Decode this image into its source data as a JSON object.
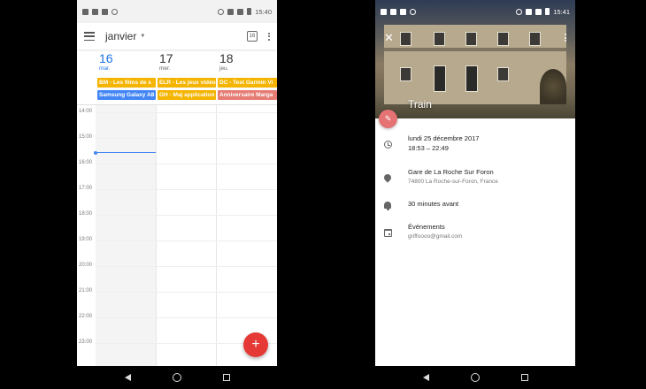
{
  "colors": {
    "primary_blue": "#1a73e8",
    "event_orange": "#f4b400",
    "event_blue": "#4285f4",
    "event_red": "#e67c73",
    "fab_red": "#e53935",
    "edit_fab_red": "#e57373"
  },
  "left": {
    "statusbar": {
      "time": "15:40"
    },
    "appbar": {
      "title": "janvier",
      "today_icon_text": "16"
    },
    "days": [
      {
        "num": "16",
        "dow": "mar."
      },
      {
        "num": "17",
        "dow": "mer."
      },
      {
        "num": "18",
        "dow": "jeu."
      }
    ],
    "allday_events": [
      {
        "label": "BM - Les films de s",
        "color": "#f4b400"
      },
      {
        "label": "Samsung Galaxy A8",
        "color": "#4285f4"
      },
      {
        "label": "ELR - Les jeux vidéo",
        "color": "#f4b400"
      },
      {
        "label": "GH - Maj application",
        "color": "#f4b400"
      },
      {
        "label": "DC - Test Garmin Vi",
        "color": "#f4b400"
      },
      {
        "label": "Anniversaire Marga",
        "color": "#e67c73"
      }
    ],
    "hours": [
      "14:00",
      "15:00",
      "16:00",
      "17:00",
      "18:00",
      "19:00",
      "20:00",
      "21:00",
      "22:00",
      "23:00"
    ],
    "fab_label": "+"
  },
  "right": {
    "statusbar": {
      "time": "15:41"
    },
    "event": {
      "title": "Train",
      "date": "lundi 25 décembre 2017",
      "time_range": "18:53 – 22:49",
      "location_name": "Gare de La Roche Sur Foron",
      "location_address": "74800 La Roche-sur-Foron, France",
      "reminder": "30 minutes avant",
      "calendar_name": "Événements",
      "calendar_account": "griffoooo@gmail.com"
    }
  }
}
